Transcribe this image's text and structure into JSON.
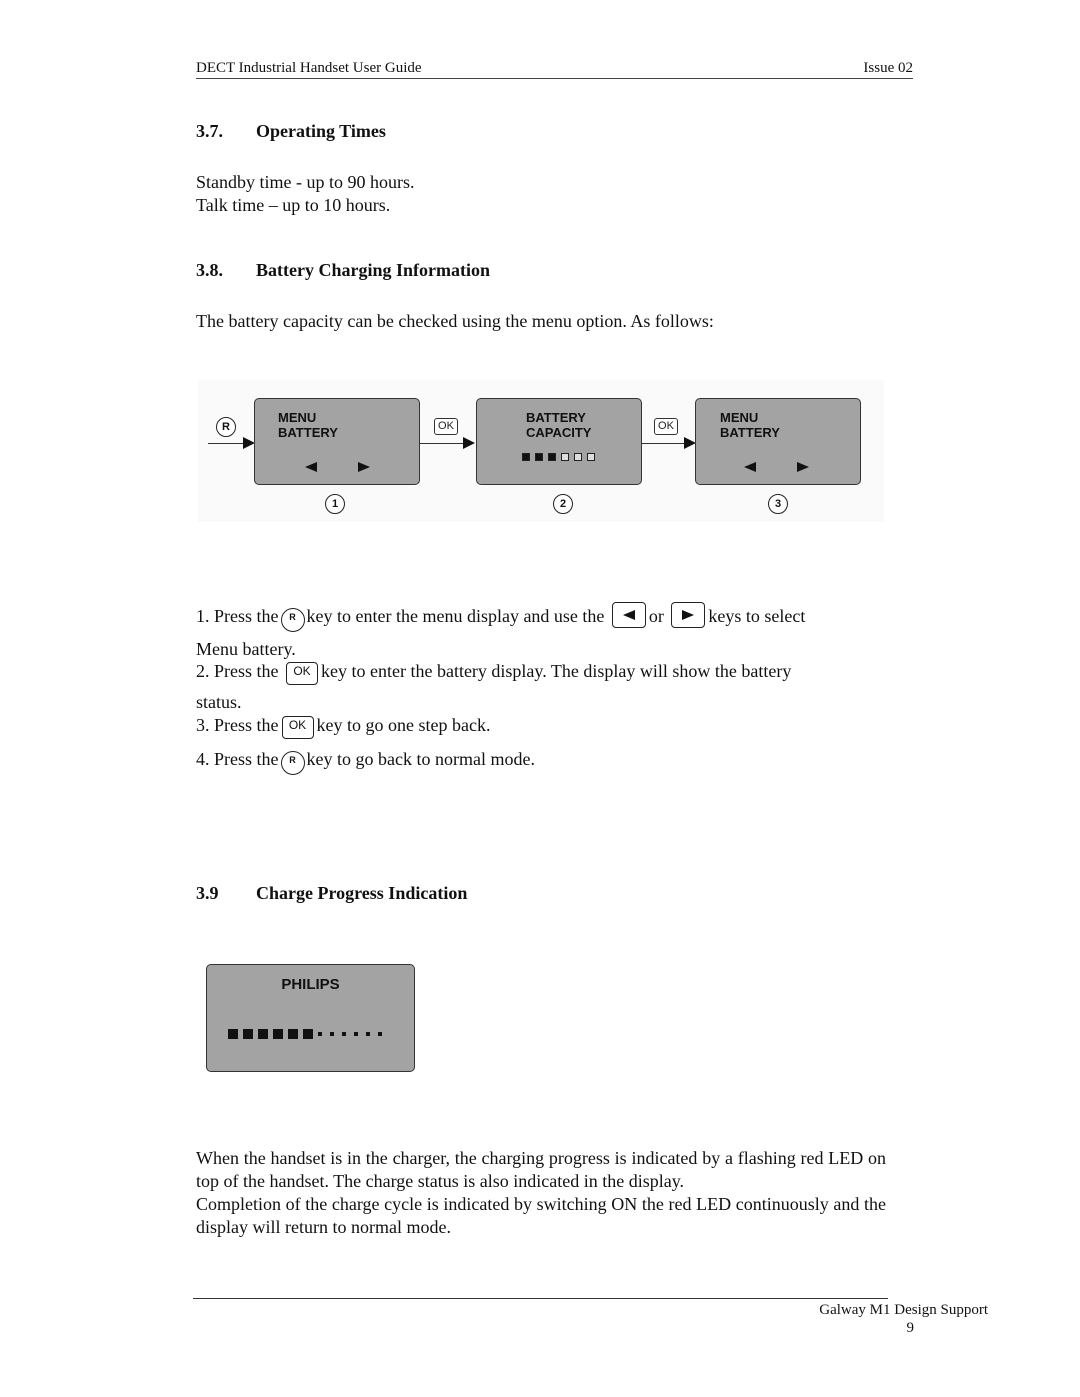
{
  "header": {
    "title": "DECT Industrial Handset User Guide",
    "issue": "Issue 02"
  },
  "section_37": {
    "number": "3.7.",
    "title": "Operating Times",
    "lines": [
      "Standby time -  up to  90 hours.",
      "Talk time – up to 10 hours."
    ]
  },
  "section_38": {
    "number": "3.8.",
    "title": "Battery Charging Information",
    "intro": "The battery capacity can be checked using the menu option. As follows:",
    "diagram": {
      "start_key": "R",
      "ok_key": "OK",
      "screens": [
        {
          "step": "1",
          "line1": "MENU",
          "line2": "BATTERY",
          "has_arrows": true
        },
        {
          "step": "2",
          "line1": "BATTERY",
          "line2": "CAPACITY",
          "battery_level": {
            "filled": 3,
            "total": 6
          }
        },
        {
          "step": "3",
          "line1": "MENU",
          "line2": "BATTERY",
          "has_arrows": true
        }
      ]
    },
    "steps": [
      {
        "pre": "1. Press the",
        "key1": "R",
        "mid": "key to enter the menu display and use the",
        "or": "or",
        "post": "keys to select",
        "cont": "Menu battery."
      },
      {
        "pre": "2. Press the",
        "key": "OK",
        "post": "key to enter the battery display. The display will show the battery",
        "cont": "status."
      },
      {
        "pre": "3. Press the",
        "key": "OK",
        "post": "key to go one step back."
      },
      {
        "pre": "4. Press the",
        "key": "R",
        "post": "key to go back to normal mode."
      }
    ]
  },
  "section_39": {
    "number": "3.9",
    "title": "Charge Progress Indication",
    "display": {
      "brand": "PHILIPS",
      "progress": {
        "filled": 6,
        "total": 12
      }
    },
    "para1": "When the handset is in the charger, the charging progress is indicated by a flashing red LED on top of the handset. The charge status is also indicated in the display.",
    "para2": "Completion of the charge cycle is indicated by switching ON the red LED continuously and the display will return to normal mode."
  },
  "footer": {
    "org": "Galway M1 Design Support",
    "page": "9"
  },
  "colors": {
    "lcd_bg": "#a3a3a3",
    "ink": "#111111"
  }
}
